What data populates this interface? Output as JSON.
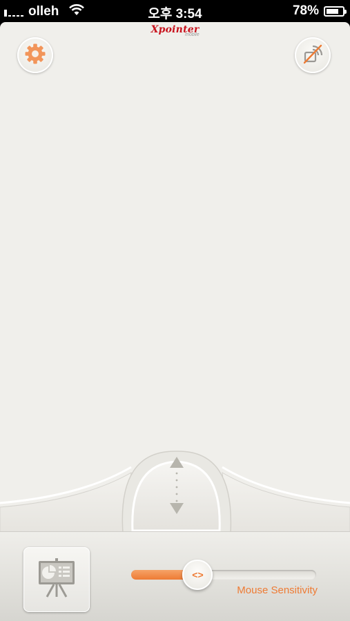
{
  "status_bar": {
    "carrier": "olleh",
    "time": "오후 3:54",
    "battery_percent_label": "78%",
    "battery_level": 0.78
  },
  "header": {
    "logo_text": "Xpointer",
    "logo_subtext": "mobile"
  },
  "icons": {
    "settings": "gear-icon",
    "connection": "wireless-disconnected-icon",
    "scroll_up": "triangle-up-icon",
    "scroll_down": "triangle-down-icon",
    "presentation": "presentation-board-icon",
    "slider_thumb": "left-right-arrows-icon"
  },
  "sensitivity": {
    "label": "Mouse Sensitivity",
    "level": 0.36,
    "thumb_glyph": "<>"
  },
  "colors": {
    "accent": "#ee7b34",
    "brand": "#c8141e",
    "background": "#f0efeb"
  }
}
